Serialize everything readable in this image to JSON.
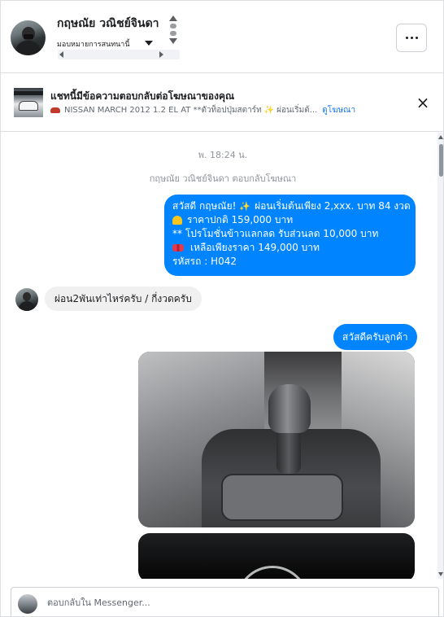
{
  "header": {
    "contact_name": "กฤษณัย วณิชย์จินดา",
    "assign_label": "มอบหมายการสนทนานี้",
    "more_button_label": "···"
  },
  "ad_banner": {
    "title": "แชทนี้มีข้อความตอบกลับต่อโฆษณาของคุณ",
    "snippet_part1": "NISSAN MARCH 2012 1.2 EL AT **ตัวท็อปปุ่มสตาร์ท",
    "snippet_part2": "ผ่อนเริ่มต้...",
    "view_ad_link": "ดูโฆษณา",
    "close_label": "×"
  },
  "chat": {
    "timestamp": "พ. 18:24 น.",
    "reply_notice": "กฤษณัย วณิชย์จินดา ตอบกลับโฆษณา",
    "outgoing_ad_message": {
      "line1_prefix": "สวัสดี กฤษณัย!",
      "line1_suffix": "ผ่อนเริ่มต้นเพียง 2,xxx. บาท 84 งวด",
      "line2": "ราคาปกติ  159,000 บาท",
      "line3": "** โปรโมชั่นข้าวแลกลด รับส่วนลด 10,000 บาท",
      "line4": "เหลือเพียงราคา 149,000 บาท",
      "line5": " รหัสรถ : H042"
    },
    "incoming_message": "ผ่อน2พันเท่าไหร่ครับ / กี่งวดครับ",
    "outgoing_reply": "สวัสดีครับลูกค้า"
  },
  "composer": {
    "placeholder": "ตอบกลับใน Messenger..."
  }
}
